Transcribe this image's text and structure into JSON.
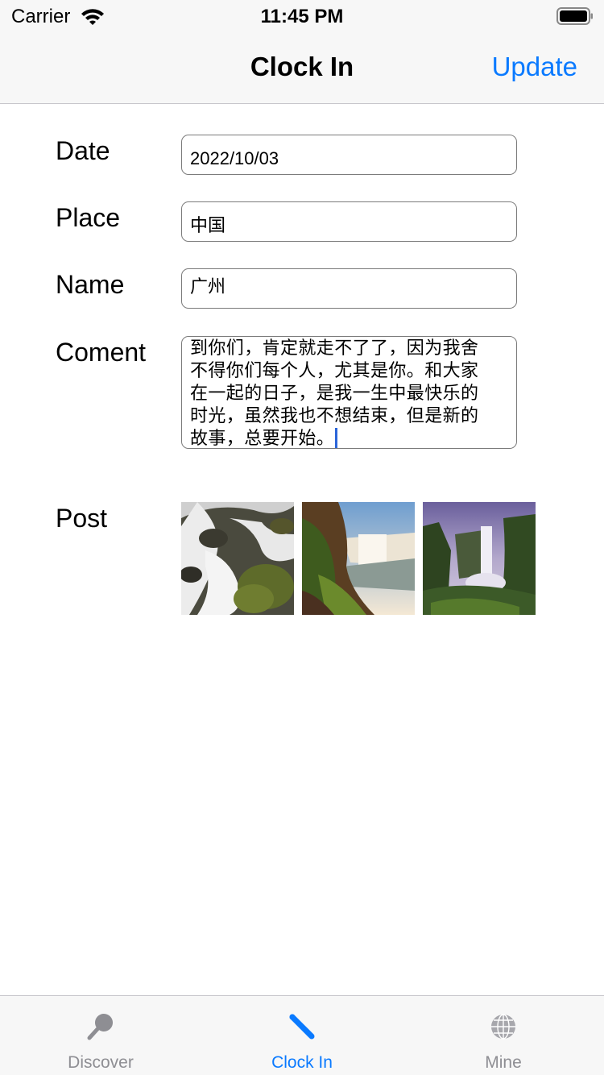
{
  "status_bar": {
    "carrier": "Carrier",
    "time": "11:45 PM"
  },
  "nav": {
    "title": "Clock In",
    "right_button": "Update"
  },
  "form": {
    "date_label": "Date",
    "date_value": "2022/10/03",
    "place_label": "Place",
    "place_value": "中国",
    "name_label": "Name",
    "name_value": "广州",
    "comment_label": "Coment",
    "comment_lines": [
      "到你们，肯定就走不了了，因为我舍",
      "不得你们每个人，尤其是你。和大家",
      "在一起的日子，是我一生中最快乐的",
      "时光，虽然我也不想结束，但是新的",
      "故事，总要开始。"
    ],
    "post_label": "Post"
  },
  "photos": [
    {
      "name": "waterfall-rocks-photo"
    },
    {
      "name": "waterfall-canyon-photo"
    },
    {
      "name": "waterfall-valley-photo"
    }
  ],
  "tabs": [
    {
      "label": "Discover",
      "icon": "magnifier-icon",
      "active": false
    },
    {
      "label": "Clock In",
      "icon": "pen-icon",
      "active": true
    },
    {
      "label": "Mine",
      "icon": "globe-icon",
      "active": false
    }
  ],
  "colors": {
    "accent": "#0a7aff",
    "inactive": "#8e8e93",
    "bar_bg": "#f7f7f7"
  }
}
